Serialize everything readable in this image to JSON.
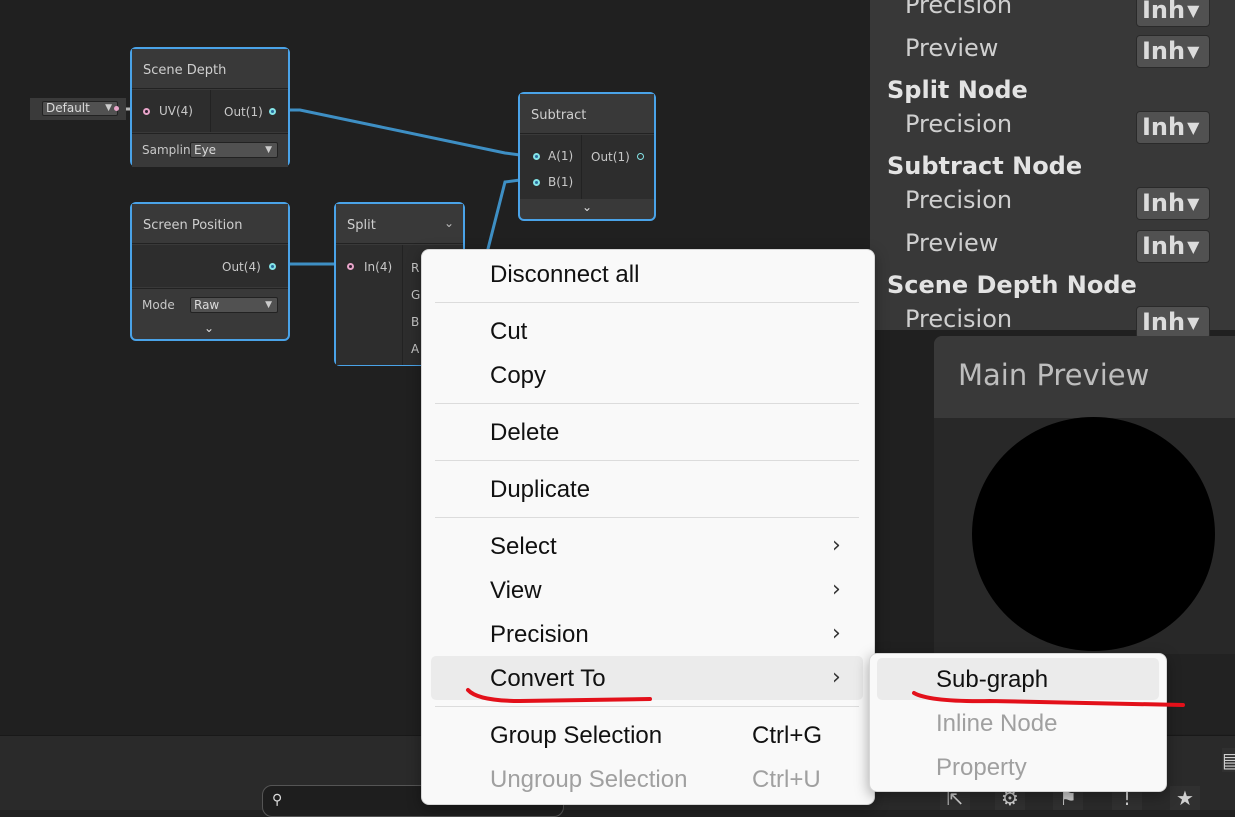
{
  "graph": {
    "nodes": {
      "scene_depth": {
        "title": "Scene Depth",
        "input_port": "UV(4)",
        "output_port": "Out(1)",
        "uv_default": "Default",
        "sampling_label": "Samplin",
        "sampling_value": "Eye"
      },
      "subtract": {
        "title": "Subtract",
        "input_a": "A(1)",
        "input_b": "B(1)",
        "output_port": "Out(1)"
      },
      "screen_position": {
        "title": "Screen Position",
        "output_port": "Out(4)",
        "mode_label": "Mode",
        "mode_value": "Raw"
      },
      "split": {
        "title": "Split",
        "input_port": "In(4)",
        "outputs": [
          "R",
          "G",
          "B",
          "A"
        ]
      }
    },
    "connection_color": "#3e8fc4"
  },
  "inspector": {
    "rows": [
      {
        "type": "label",
        "text": "Precision",
        "value": "Inh"
      },
      {
        "type": "label",
        "text": "Preview",
        "value": "Inh"
      },
      {
        "type": "heading",
        "text": "Split Node"
      },
      {
        "type": "label",
        "text": "Precision",
        "value": "Inh"
      },
      {
        "type": "heading",
        "text": "Subtract Node"
      },
      {
        "type": "label",
        "text": "Precision",
        "value": "Inh"
      },
      {
        "type": "label",
        "text": "Preview",
        "value": "Inh"
      },
      {
        "type": "heading",
        "text": "Scene Depth Node"
      },
      {
        "type": "label",
        "text": "Precision",
        "value": "Inh"
      }
    ]
  },
  "preview": {
    "title": "Main Preview"
  },
  "context_menu": {
    "items": [
      {
        "label": "Disconnect all"
      },
      {
        "label": "Cut"
      },
      {
        "label": "Copy"
      },
      {
        "label": "Delete"
      },
      {
        "label": "Duplicate"
      },
      {
        "label": "Select",
        "submenu": true
      },
      {
        "label": "View",
        "submenu": true
      },
      {
        "label": "Precision",
        "submenu": true
      },
      {
        "label": "Convert To",
        "submenu": true,
        "highlighted": true
      },
      {
        "label": "Group Selection",
        "shortcut": "Ctrl+G"
      },
      {
        "label": "Ungroup Selection",
        "shortcut": "Ctrl+U",
        "disabled": true
      }
    ],
    "submenu": {
      "items": [
        {
          "label": "Sub-graph",
          "highlighted": true
        },
        {
          "label": "Inline Node",
          "disabled": true
        },
        {
          "label": "Property",
          "disabled": true
        }
      ]
    }
  },
  "annotation_color": "#e3101a",
  "toolbar": {
    "icons": [
      "import-icon",
      "settings-icon",
      "tag-icon",
      "warning-icon",
      "star-icon"
    ]
  }
}
